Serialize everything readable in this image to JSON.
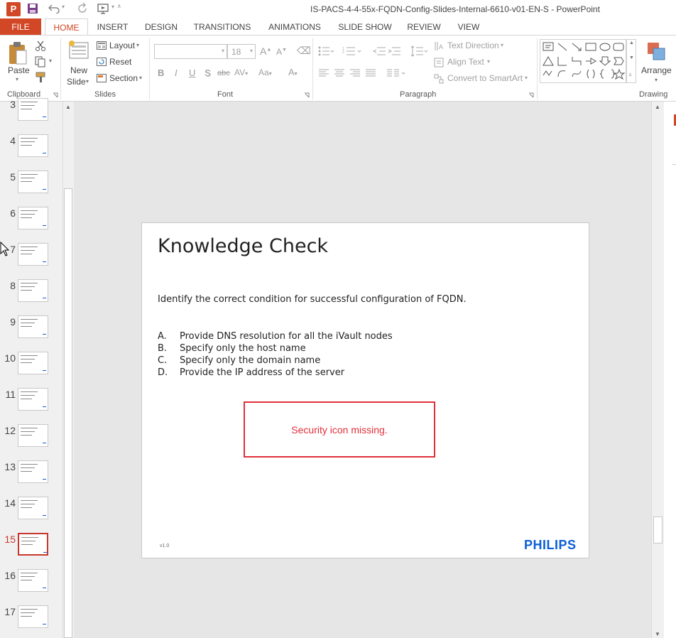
{
  "app": {
    "window_title": "IS-PACS-4-4-55x-FQDN-Config-Slides-Internal-6610-v01-EN-S - PowerPoint"
  },
  "ribbon_tabs": [
    "FILE",
    "HOME",
    "INSERT",
    "DESIGN",
    "TRANSITIONS",
    "ANIMATIONS",
    "SLIDE SHOW",
    "REVIEW",
    "VIEW"
  ],
  "clipboard": {
    "paste": "Paste",
    "label": "Clipboard"
  },
  "slides_group": {
    "new_slide_1": "New",
    "new_slide_2": "Slide",
    "layout": "Layout",
    "reset": "Reset",
    "section": "Section",
    "label": "Slides"
  },
  "font_group": {
    "font_name": "",
    "font_size": "18",
    "label": "Font"
  },
  "paragraph_group": {
    "text_direction": "Text Direction",
    "align_text": "Align Text",
    "convert_smartart": "Convert to SmartArt",
    "label": "Paragraph"
  },
  "drawing_group": {
    "arrange": "Arrange",
    "label": "Drawing"
  },
  "thumbnails": [
    "3",
    "4",
    "5",
    "6",
    "7",
    "8",
    "9",
    "10",
    "11",
    "12",
    "13",
    "14",
    "15",
    "16",
    "17"
  ],
  "selected_slide": "15",
  "slide": {
    "title": "Knowledge Check",
    "question": "Identify the correct condition for successful configuration of FQDN.",
    "options": [
      {
        "letter": "A.",
        "text": "Provide DNS resolution for all the iVault nodes"
      },
      {
        "letter": "B.",
        "text": "Specify only the host name"
      },
      {
        "letter": "C.",
        "text": "Specify only the domain name"
      },
      {
        "letter": "D.",
        "text": "Provide the IP address of the server"
      }
    ],
    "warning": "Security icon missing.",
    "version": "v1.0",
    "logo": "PHILIPS"
  },
  "colors": {
    "accent": "#d24726",
    "warning": "#e0303a",
    "philips_blue": "#0b5ed7"
  }
}
